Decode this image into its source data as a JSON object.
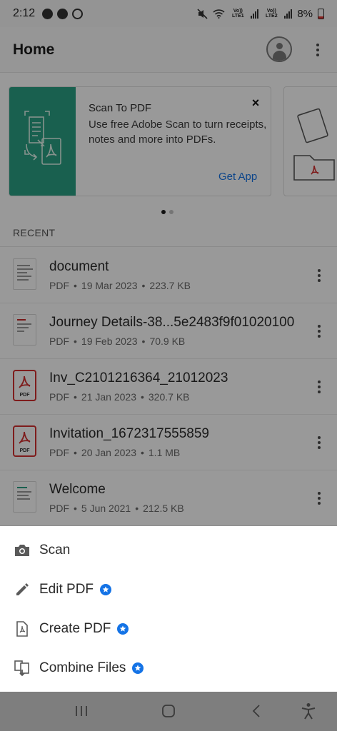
{
  "status_bar": {
    "time": "2:12",
    "carrier1": "Vo)) LTE1",
    "carrier2": "Vo)) LTE2",
    "battery": "8%"
  },
  "app_bar": {
    "title": "Home"
  },
  "promo_card": {
    "title": "Scan To PDF",
    "description": "Use free Adobe Scan to turn receipts, notes and more into PDFs.",
    "close_label": "×",
    "cta": "Get App",
    "accent_color": "#2aa184"
  },
  "recent": {
    "section_label": "RECENT",
    "files": [
      {
        "name": "document",
        "type": "PDF",
        "date": "19 Mar 2023",
        "size": "223.7 KB",
        "thumb": "doc"
      },
      {
        "name": "Journey Details-38...5e2483f9f01020100",
        "type": "PDF",
        "date": "19 Feb 2023",
        "size": "70.9 KB",
        "thumb": "doc-red"
      },
      {
        "name": "Inv_C2101216364_21012023",
        "type": "PDF",
        "date": "21 Jan 2023",
        "size": "320.7 KB",
        "thumb": "pdf"
      },
      {
        "name": "Invitation_1672317555859",
        "type": "PDF",
        "date": "20 Jan 2023",
        "size": "1.1 MB",
        "thumb": "pdf"
      },
      {
        "name": "Welcome",
        "type": "PDF",
        "date": "5 Jun 2021",
        "size": "212.5 KB",
        "thumb": "doc-green"
      }
    ],
    "separator": "•"
  },
  "bottom_sheet": {
    "items": [
      {
        "label": "Scan",
        "icon": "camera-icon",
        "premium": false
      },
      {
        "label": "Edit PDF",
        "icon": "pencil-icon",
        "premium": true
      },
      {
        "label": "Create PDF",
        "icon": "create-pdf-icon",
        "premium": true
      },
      {
        "label": "Combine Files",
        "icon": "combine-files-icon",
        "premium": true
      }
    ],
    "premium_color": "#1473e6"
  },
  "pdf_thumb_label": "PDF"
}
